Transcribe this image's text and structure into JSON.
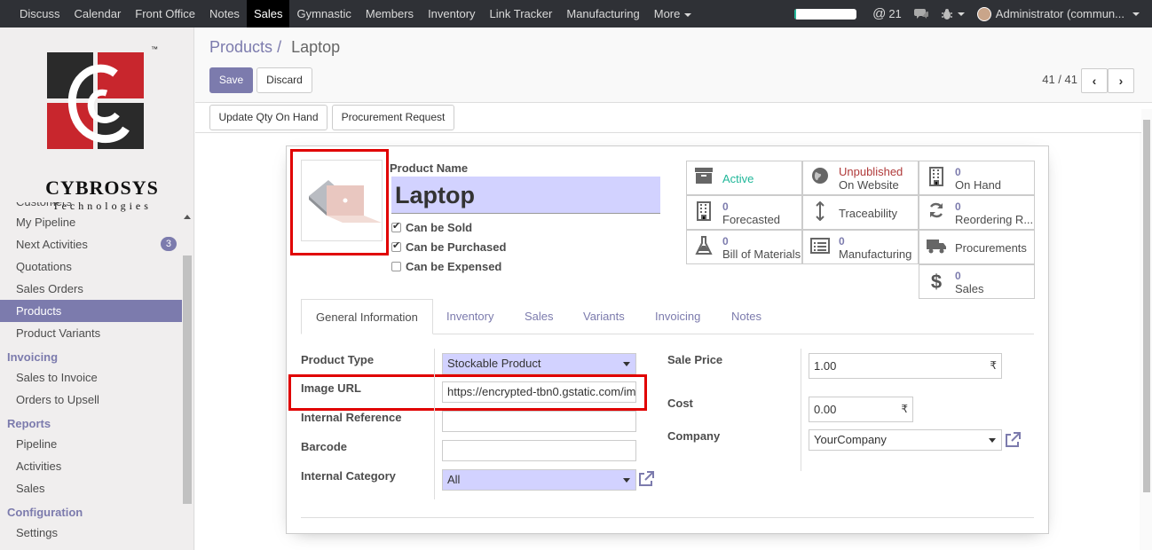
{
  "topbar": {
    "menu": [
      "Discuss",
      "Calendar",
      "Front Office",
      "Notes",
      "Sales",
      "Gymnastic",
      "Members",
      "Inventory",
      "Link Tracker",
      "Manufacturing",
      "More"
    ],
    "active": "Sales",
    "progress": 0.03,
    "mentions": "21",
    "user": "Administrator (commun..."
  },
  "logo": {
    "name": "CYBROSYS",
    "sub": "Technologies",
    "tm": "™"
  },
  "sidebar": {
    "partial": "Customers",
    "items": [
      {
        "label": "My Pipeline"
      },
      {
        "label": "Next Activities",
        "badge": "3"
      },
      {
        "label": "Quotations"
      },
      {
        "label": "Sales Orders"
      },
      {
        "label": "Products"
      },
      {
        "label": "Product Variants"
      }
    ],
    "invoicing_head": "Invoicing",
    "invoicing": [
      "Sales to Invoice",
      "Orders to Upsell"
    ],
    "reports_head": "Reports",
    "reports": [
      "Pipeline",
      "Activities",
      "Sales"
    ],
    "config_head": "Configuration",
    "config_partial": "Settings"
  },
  "breadcrumb": {
    "parent": "Products",
    "sep": "/",
    "current": "Laptop"
  },
  "buttons": {
    "save": "Save",
    "discard": "Discard",
    "update_qty": "Update Qty On Hand",
    "procurement": "Procurement Request"
  },
  "pager": {
    "value": "41 / 41",
    "prev": "‹",
    "next": "›"
  },
  "form": {
    "product_name_label": "Product Name",
    "product_name": "Laptop",
    "can_be_sold": "Can be Sold",
    "can_be_purchased": "Can be Purchased",
    "can_be_expensed": "Can be Expensed"
  },
  "stats": {
    "active": "Active",
    "website_top": "Unpublished",
    "website_bottom": "On Website",
    "onhand_val": "0",
    "onhand": "On Hand",
    "forecast_val": "0",
    "forecast": "Forecasted",
    "traceability": "Traceability",
    "reorder_val": "0",
    "reorder": "Reordering R...",
    "bom_val": "0",
    "bom": "Bill of Materials",
    "mfg_val": "0",
    "mfg": "Manufacturing",
    "procurements": "Procurements",
    "sales_val": "0",
    "sales": "Sales"
  },
  "tabs": [
    "General Information",
    "Inventory",
    "Sales",
    "Variants",
    "Invoicing",
    "Notes"
  ],
  "fields": {
    "product_type_label": "Product Type",
    "product_type": "Stockable Product",
    "image_url_label": "Image URL",
    "image_url": "https://encrypted-tbn0.gstatic.com/im",
    "internal_ref_label": "Internal Reference",
    "internal_ref": "",
    "barcode_label": "Barcode",
    "barcode": "",
    "category_label": "Internal Category",
    "category": "All",
    "sale_price_label": "Sale Price",
    "sale_price": "1.00",
    "cost_label": "Cost",
    "cost": "0.00",
    "currency": "₹",
    "company_label": "Company",
    "company": "YourCompany"
  }
}
